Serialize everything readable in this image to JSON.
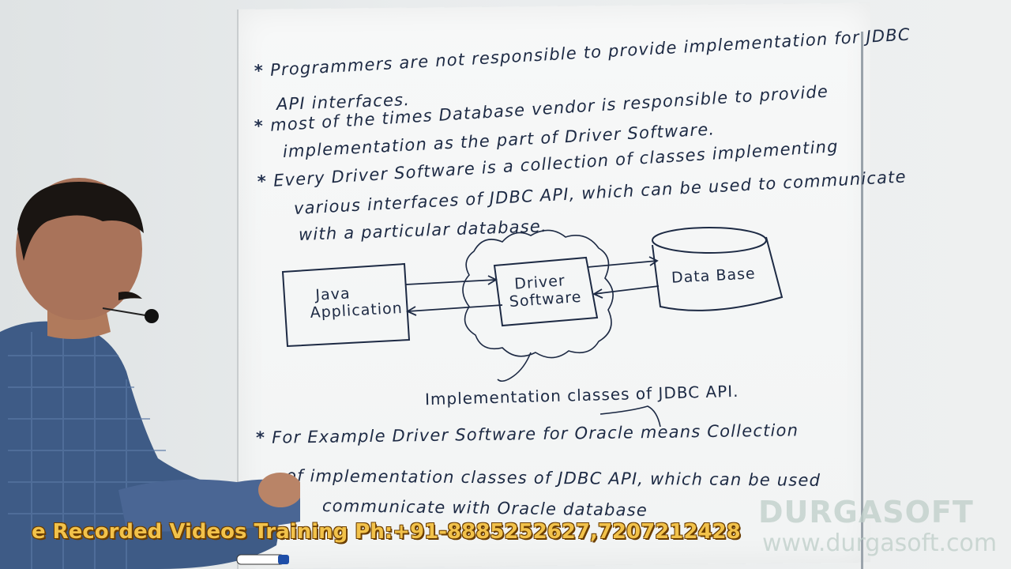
{
  "board": {
    "bullet_1": {
      "star": "*",
      "line1": "Programmers are not responsible to provide implementation for JDBC",
      "line2": "API interfaces."
    },
    "bullet_2": {
      "star": "*",
      "line1": "most of the times Database vendor is responsible to provide",
      "line2": "implementation as the part of Driver Software."
    },
    "bullet_3": {
      "star": "*",
      "line1": "Every Driver Software is a collection of classes implementing",
      "line2": "various interfaces of JDBC API, which can be used to communicate",
      "line3": "with a particular database."
    },
    "diagram": {
      "java_box_line1": "Java",
      "java_box_line2": "Application",
      "driver_box_line1": "Driver",
      "driver_box_line2": "Software",
      "database_label": "Data Base",
      "impl_caption": "Implementation classes of JDBC API."
    },
    "bullet_4": {
      "star": "*",
      "line1": "For Example Driver Software for Oracle means Collection",
      "line2": "of implementation classes of JDBC API, which can be used",
      "line3": "communicate with Oracle database"
    }
  },
  "overlay": {
    "banner": "e Recorded Videos Training Ph:+91-8885252627,7207212428",
    "watermark_brand": "DURGASOFT",
    "watermark_url": "www.durgasoft.com"
  },
  "colors": {
    "ink": "#1d2a44",
    "banner_text": "#f2c24a",
    "shirt": "#3e5b86"
  }
}
